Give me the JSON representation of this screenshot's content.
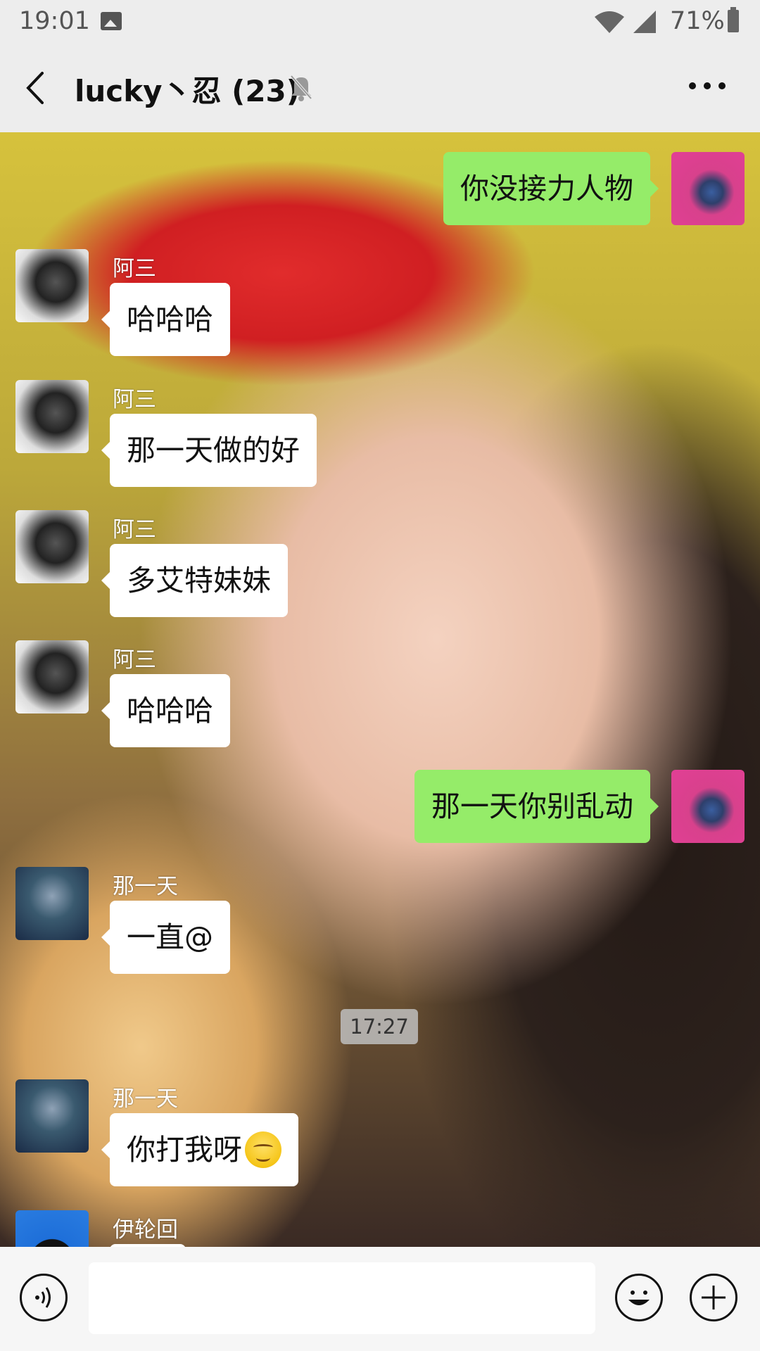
{
  "status_bar": {
    "time": "19:01",
    "battery_percent": "71%",
    "icons": [
      "image-icon",
      "wifi-icon",
      "signal-icon",
      "battery-icon"
    ]
  },
  "header": {
    "title": "lucky丶忍 (23)",
    "back_icon": "chevron-left-icon",
    "mute_icon": "bell-muted-icon",
    "more_icon": "more-dots-icon"
  },
  "messages": [
    {
      "side": "right",
      "sender": "",
      "text": "你没接力人物"
    },
    {
      "side": "left",
      "sender": "阿三",
      "text": "哈哈哈"
    },
    {
      "side": "left",
      "sender": "阿三",
      "text": "那一天做的好"
    },
    {
      "side": "left",
      "sender": "阿三",
      "text": "多艾特妹妹"
    },
    {
      "side": "left",
      "sender": "阿三",
      "text": "哈哈哈"
    },
    {
      "side": "right",
      "sender": "",
      "text": "那一天你别乱动"
    },
    {
      "side": "left",
      "sender": "那一天",
      "text": "一直@"
    },
    {
      "side": "left",
      "sender": "那一天",
      "text": "你打我呀",
      "emoji": "smirk-emoji"
    },
    {
      "side": "left",
      "sender": "伊轮回",
      "text": ""
    }
  ],
  "timestamp": "17:27",
  "input_bar": {
    "voice_icon": "voice-icon",
    "emoji_icon": "smiley-icon",
    "plus_icon": "plus-icon",
    "input_value": ""
  }
}
